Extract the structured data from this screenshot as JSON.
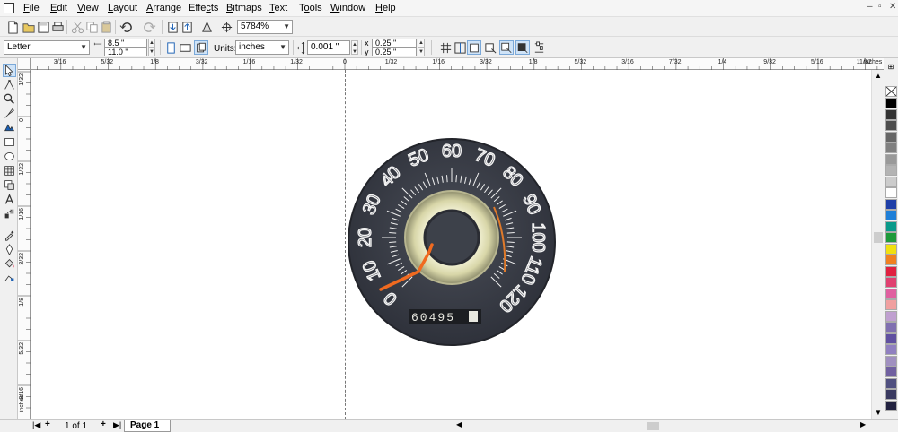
{
  "menubar": {
    "items": [
      {
        "label": "File",
        "accel": "F",
        "rest": "ile"
      },
      {
        "label": "Edit",
        "accel": "E",
        "rest": "dit"
      },
      {
        "label": "View",
        "accel": "V",
        "rest": "iew"
      },
      {
        "label": "Layout",
        "accel": "L",
        "rest": "ayout"
      },
      {
        "label": "Arrange",
        "accel": "A",
        "rest": "rrange"
      },
      {
        "label": "Effects",
        "pre": "Effe",
        "accel": "c",
        "rest": "ts"
      },
      {
        "label": "Bitmaps",
        "accel": "B",
        "rest": "itmaps"
      },
      {
        "label": "Text",
        "accel": "T",
        "rest": "ext"
      },
      {
        "label": "Tools",
        "pre": "T",
        "accel": "o",
        "rest": "ols"
      },
      {
        "label": "Window",
        "accel": "W",
        "rest": "indow"
      },
      {
        "label": "Help",
        "accel": "H",
        "rest": "elp"
      }
    ],
    "window_buttons": [
      "–",
      "▫",
      "✕"
    ]
  },
  "toolbar1": {
    "zoom_value": "5784%"
  },
  "toolbar2": {
    "paper_size": "Letter",
    "page_width": "8.5 \"",
    "page_height": "11.0 \"",
    "units_label": "Units:",
    "units_value": "inches",
    "nudge_value": "0.001 \"",
    "dup_x": "0.25 \"",
    "dup_y": "0.25 \"",
    "dup_x_label": "x",
    "dup_y_label": "y"
  },
  "hruler": {
    "labels": [
      "3/16",
      "5/32",
      "1/8",
      "3/32",
      "1/16",
      "1/32",
      "0",
      "1/32",
      "1/16",
      "3/32",
      "1/8",
      "5/32",
      "3/16",
      "7/32",
      "1/4",
      "9/32",
      "5/16",
      "11/32"
    ],
    "units": "inches"
  },
  "vruler": {
    "labels": [
      "1/32",
      "0",
      "1/32",
      "1/16",
      "3/32",
      "1/8",
      "5/32",
      "3/16"
    ],
    "units": "inches"
  },
  "canvas": {
    "odometer": "60495"
  },
  "pagebar": {
    "page_counter": "1 of 1",
    "page_tab": "Page 1"
  },
  "palette": {
    "colors": [
      "#000000",
      "#333333",
      "#4d4d4d",
      "#666666",
      "#808080",
      "#999999",
      "#b3b3b3",
      "#cccccc",
      "#ffffff",
      "#1f3fa8",
      "#1e7fd8",
      "#0a9a8a",
      "#1e9a3a",
      "#f0e010",
      "#f08020",
      "#e02040",
      "#e04070",
      "#e060a0",
      "#f0a0a0",
      "#c0a0d0",
      "#8070b0",
      "#6050a0",
      "#9080c0",
      "#a090c0",
      "#7060a0",
      "#505080",
      "#3a3a60",
      "#222240"
    ]
  }
}
